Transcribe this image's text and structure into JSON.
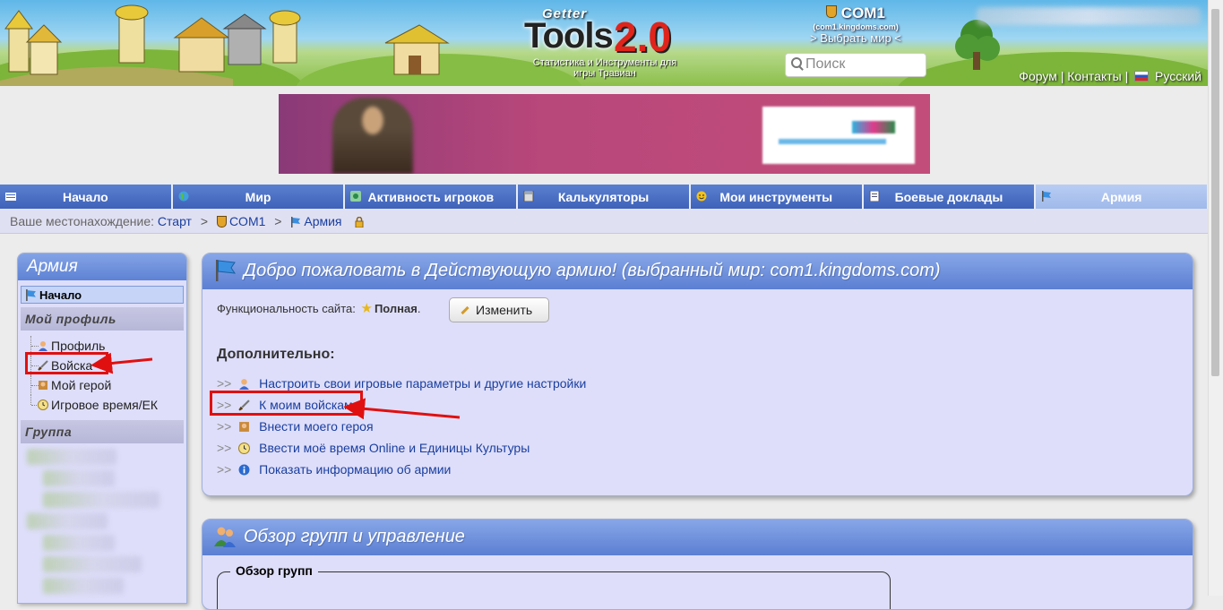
{
  "header": {
    "logo": {
      "getter": "Getter",
      "tools": "Tools",
      "version": "2.0",
      "subtitle": "Статистика и Инструменты для игры Травиан"
    },
    "world": {
      "name": "COM1",
      "domain": "(com1.kingdoms.com)",
      "select": "> Выбрать мир <"
    },
    "search_placeholder": "Поиск",
    "links": {
      "forum": "Форум",
      "contacts": "Контакты",
      "language": "Русский",
      "sep": "|"
    }
  },
  "nav": {
    "tabs": [
      {
        "label": "Начало",
        "icon": "home-icon"
      },
      {
        "label": "Мир",
        "icon": "globe-icon"
      },
      {
        "label": "Активность игроков",
        "icon": "activity-icon"
      },
      {
        "label": "Калькуляторы",
        "icon": "calculator-icon"
      },
      {
        "label": "Мои инструменты",
        "icon": "smiley-icon"
      },
      {
        "label": "Боевые доклады",
        "icon": "report-icon"
      },
      {
        "label": "Армия",
        "icon": "flag-icon"
      }
    ],
    "active_tab": "Армия"
  },
  "breadcrumb": {
    "prefix": "Ваше местонахождение:",
    "start": "Старт",
    "world": "COM1",
    "army": "Армия",
    "sep": ">"
  },
  "sidebar": {
    "title": "Армия",
    "start": "Начало",
    "profile_section": "Мой профиль",
    "items": [
      {
        "label": "Профиль",
        "icon": "user-icon"
      },
      {
        "label": "Войска",
        "icon": "sword-icon"
      },
      {
        "label": "Мой герой",
        "icon": "hero-icon"
      },
      {
        "label": "Игровое время/ЕК",
        "icon": "clock-icon"
      }
    ],
    "group_section": "Группа"
  },
  "welcome": {
    "title": "Добро пожаловать в Действующую армию! (выбранный мир: com1.kingdoms.com)",
    "func_label": "Функциональность сайта:",
    "func_value": "Полная",
    "change_button": "Изменить",
    "additional": "Дополнительно:",
    "links": [
      {
        "label": "Настроить свои игровые параметры и другие настройки",
        "icon": "user-icon"
      },
      {
        "label": "К моим войскам",
        "icon": "sword-icon"
      },
      {
        "label": "Внести моего героя",
        "icon": "hero-icon"
      },
      {
        "label": "Ввести моё время Online и Единицы Культуры",
        "icon": "clock-icon"
      },
      {
        "label": "Показать информацию об армии",
        "icon": "info-icon"
      }
    ],
    "arrows": ">>"
  },
  "groups": {
    "title": "Обзор групп и управление",
    "fieldset_legend": "Обзор групп"
  },
  "colors": {
    "nav_blue": "#4a6ec4",
    "panel_bg": "#dedefa",
    "annotation_red": "#e01010"
  }
}
